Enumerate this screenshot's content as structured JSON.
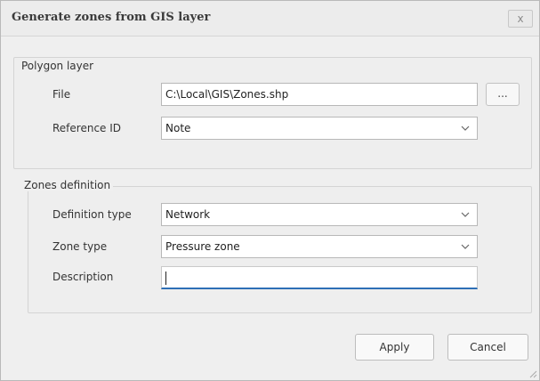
{
  "dialog": {
    "title": "Generate zones from GIS layer",
    "close_label": "x"
  },
  "polygon_layer": {
    "title": "Polygon layer",
    "file_label": "File",
    "file_value": "C:\\Local\\GIS\\Zones.shp",
    "browse_label": "...",
    "reference_id_label": "Reference ID",
    "reference_id_value": "Note"
  },
  "zones_definition": {
    "title": "Zones definition",
    "definition_type_label": "Definition type",
    "definition_type_value": "Network",
    "zone_type_label": "Zone type",
    "zone_type_value": "Pressure zone",
    "description_label": "Description",
    "description_value": ""
  },
  "buttons": {
    "apply": "Apply",
    "cancel": "Cancel"
  },
  "icons": {
    "dropdown": "chevron-down-icon",
    "close": "close-icon",
    "resize": "resize-grip-icon"
  },
  "colors": {
    "focus_underline": "#2d6fb6"
  }
}
